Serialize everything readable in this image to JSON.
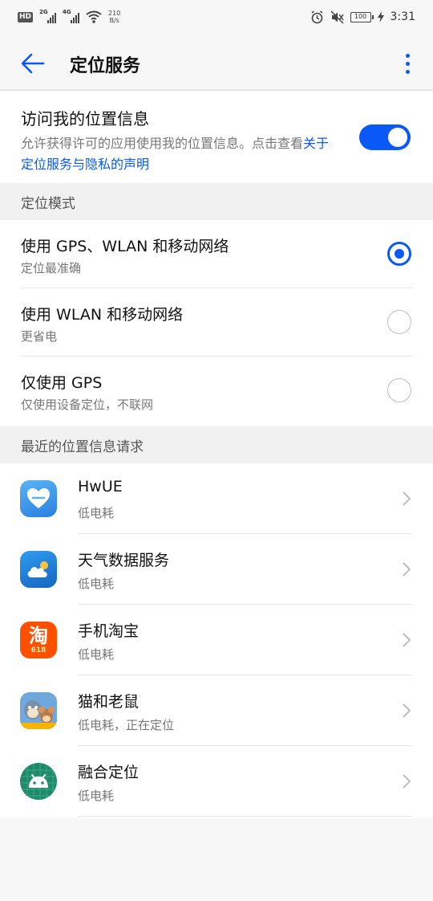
{
  "status_bar": {
    "hd": "HD",
    "sig1_tag": "2G",
    "sig2_tag": "4G",
    "net_speed_value": "210",
    "net_speed_unit": "B/s",
    "battery": "100",
    "time": "3:31"
  },
  "header": {
    "title": "定位服务"
  },
  "access": {
    "title": "访问我的位置信息",
    "desc_prefix": "允许获得许可的应用使用我的位置信息。点击查看",
    "desc_link": "关于定位服务与隐私的声明",
    "enabled": true
  },
  "mode_section": {
    "header": "定位模式",
    "options": [
      {
        "title": "使用 GPS、WLAN 和移动网络",
        "sub": "定位最准确",
        "selected": true
      },
      {
        "title": "使用 WLAN 和移动网络",
        "sub": "更省电",
        "selected": false
      },
      {
        "title": "仅使用 GPS",
        "sub": "仅使用设备定位，不联网",
        "selected": false
      }
    ]
  },
  "recent_section": {
    "header": "最近的位置信息请求",
    "apps": [
      {
        "name": "HwUE",
        "sub": "低电耗",
        "icon": "hwue-icon"
      },
      {
        "name": "天气数据服务",
        "sub": "低电耗",
        "icon": "weather-icon"
      },
      {
        "name": "手机淘宝",
        "sub": "低电耗",
        "icon": "taobao-icon",
        "icon_text": "淘",
        "icon_badge": "618"
      },
      {
        "name": "猫和老鼠",
        "sub": "低电耗，正在定位",
        "icon": "tom-jerry-icon"
      },
      {
        "name": "融合定位",
        "sub": "低电耗",
        "icon": "android-icon"
      }
    ]
  },
  "colors": {
    "accent": "#0a59f7",
    "taobao": "#ff5000",
    "weather": "#1e88e5",
    "android": "#1f8a6a"
  }
}
